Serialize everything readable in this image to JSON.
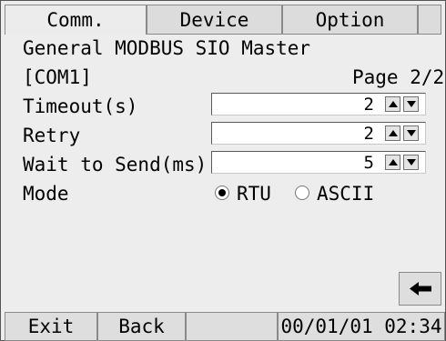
{
  "tabs": [
    {
      "label": "Comm."
    },
    {
      "label": "Device"
    },
    {
      "label": "Option"
    },
    {
      "label": ""
    }
  ],
  "header": {
    "title": "General MODBUS SIO Master",
    "port": "[COM1]",
    "page": "Page 2/2"
  },
  "fields": [
    {
      "label": "Timeout(s)",
      "value": "2"
    },
    {
      "label": "Retry",
      "value": "2"
    },
    {
      "label": "Wait to Send(ms)",
      "value": "5"
    }
  ],
  "mode": {
    "label": "Mode",
    "options": [
      "RTU",
      "ASCII"
    ],
    "selected": "RTU"
  },
  "footer": {
    "exit": "Exit",
    "back": "Back",
    "datetime": "00/01/01 02:34"
  },
  "icons": {
    "spin_up": "triangle-up-icon",
    "spin_down": "triangle-down-icon",
    "back_arrow": "left-arrow-icon"
  }
}
